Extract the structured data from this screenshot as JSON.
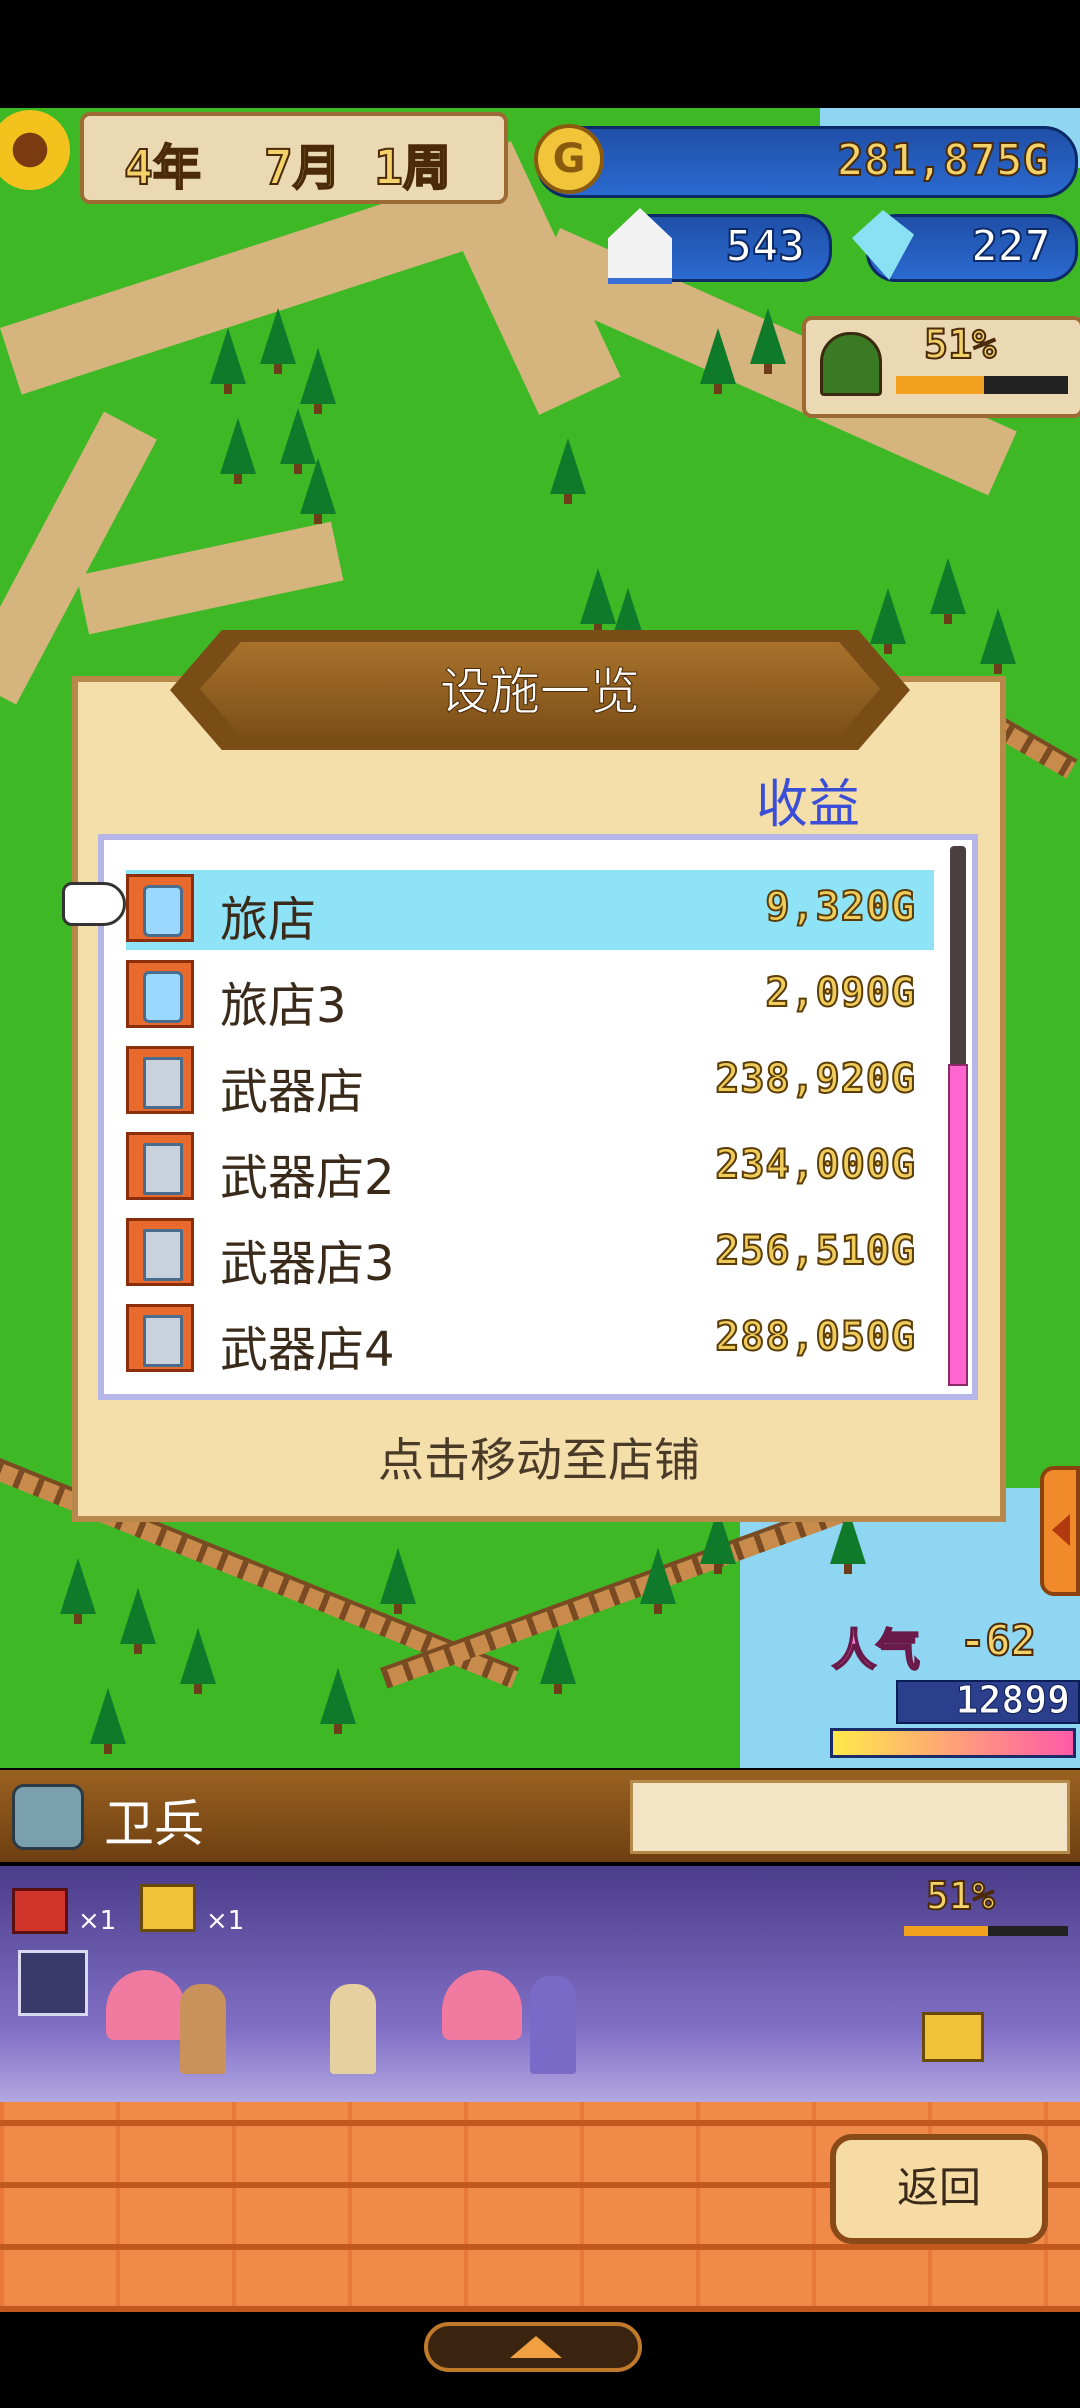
{
  "hud": {
    "year": "4年",
    "month": "7月",
    "week": "1周",
    "gold": "281,875G",
    "population": "543",
    "crystals": "227",
    "build_progress": "51%",
    "popularity_label": "人气",
    "popularity_change": "-62",
    "popularity_value": "12899"
  },
  "dialog": {
    "title": "设施一览",
    "column_header": "收益",
    "footer": "点击移动至店铺",
    "rows": [
      {
        "name": "旅店",
        "value": "9,320G",
        "selected": true
      },
      {
        "name": "旅店3",
        "value": "2,090G"
      },
      {
        "name": "武器店",
        "value": "238,920G"
      },
      {
        "name": "武器店2",
        "value": "234,000G"
      },
      {
        "name": "武器店3",
        "value": "256,510G"
      },
      {
        "name": "武器店4",
        "value": "288,050G"
      }
    ]
  },
  "unit": {
    "name": "卫兵",
    "chest_red_count": "×1",
    "chest_gold_count": "×1",
    "progress": "51%"
  },
  "buttons": {
    "back": "返回"
  },
  "colors": {
    "selected_row": "#8ee3f6",
    "header_blue": "#3a4fd6",
    "scrollbar": "#ff66d2"
  }
}
